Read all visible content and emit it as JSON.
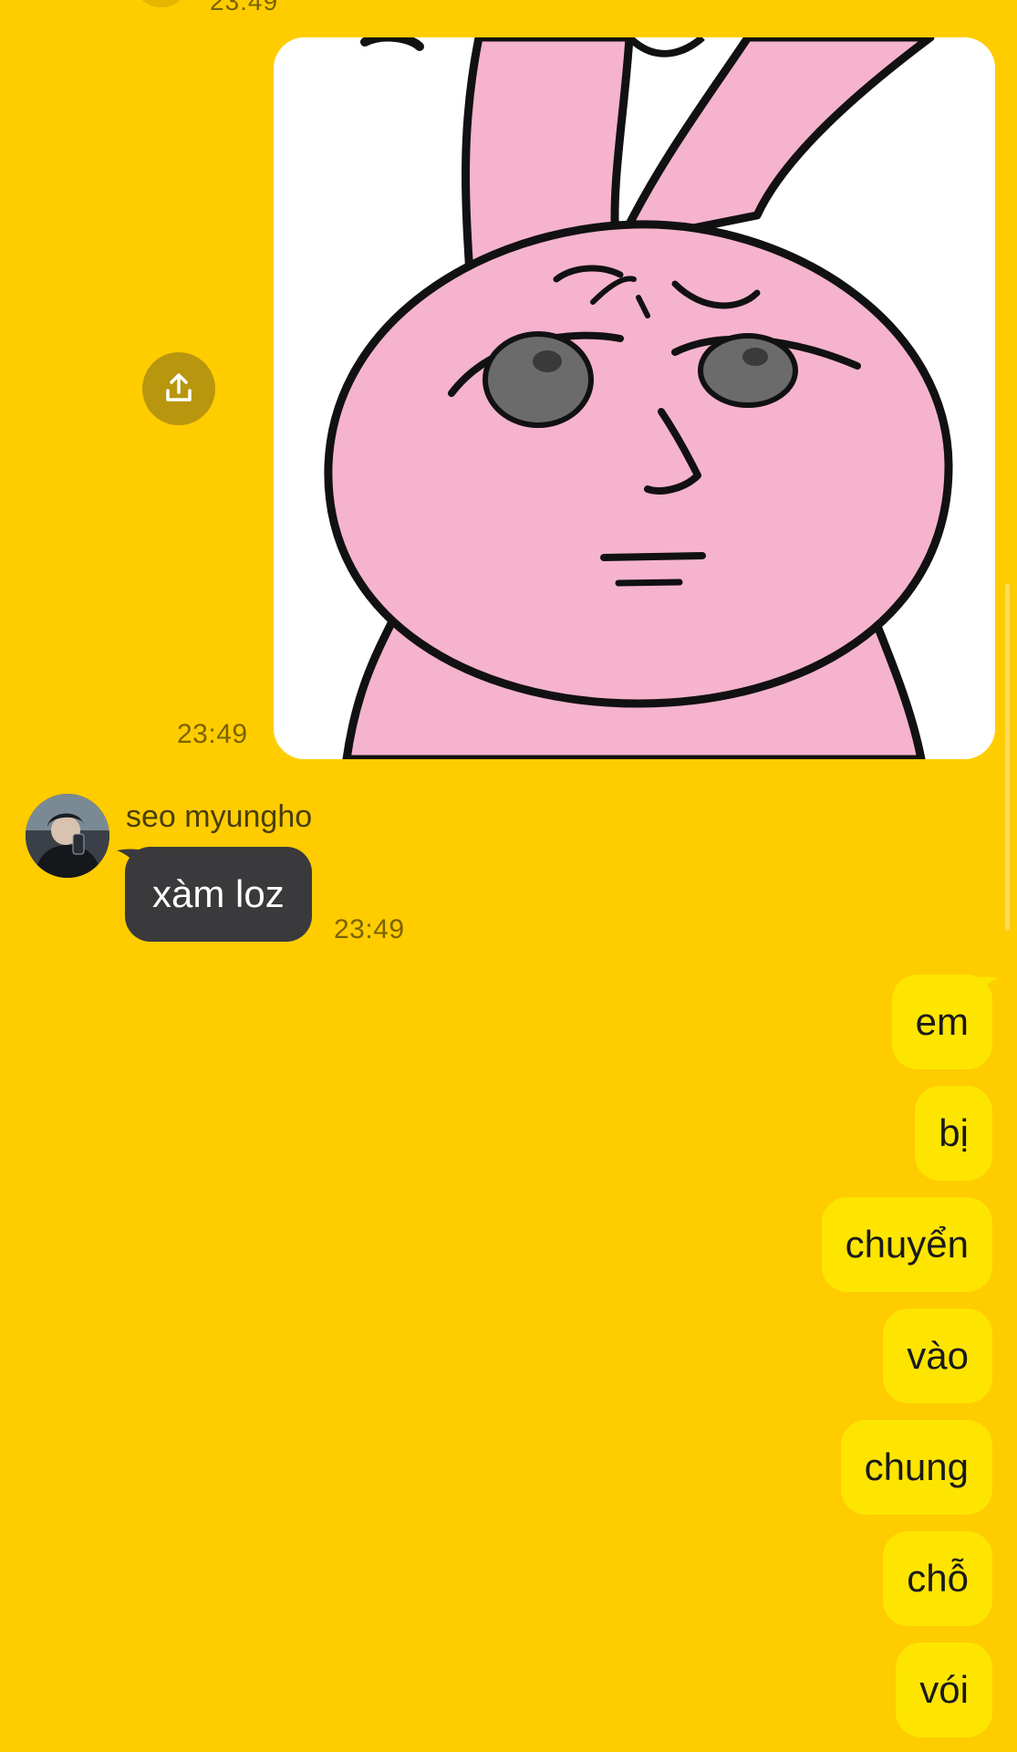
{
  "colors": {
    "background": "#FFCC00",
    "outgoing_bubble": "#FEE500",
    "incoming_bubble": "#3A3A3C",
    "share_button": "#B8960E",
    "timestamp": "#7A6300"
  },
  "previous_message": {
    "time": "23:49"
  },
  "image_message": {
    "image_description": "pink bunny sticker with a skeptical face",
    "time": "23:49",
    "share_icon": "share-upload-icon"
  },
  "incoming_message": {
    "sender": "seo myungho",
    "text": "xàm loz",
    "time": "23:49",
    "avatar_icon": "avatar-photo"
  },
  "outgoing_messages": [
    {
      "text": "em"
    },
    {
      "text": "bị"
    },
    {
      "text": "chuyển"
    },
    {
      "text": "vào"
    },
    {
      "text": "chung"
    },
    {
      "text": "chỗ"
    },
    {
      "text": "vói"
    }
  ]
}
